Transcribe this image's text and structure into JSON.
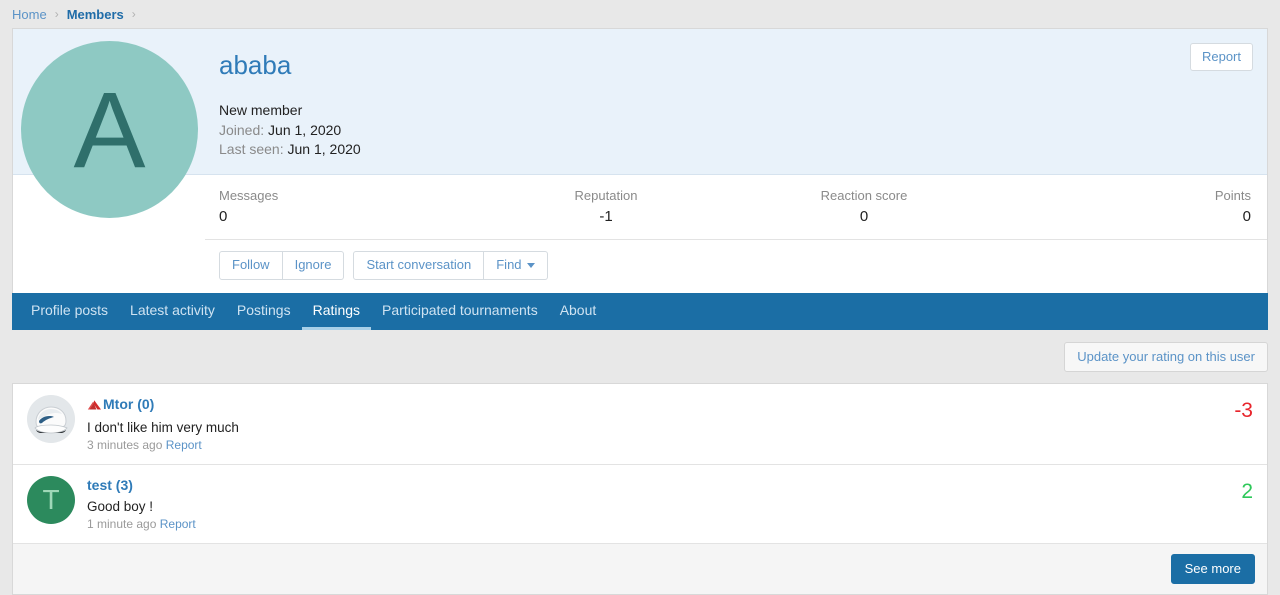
{
  "breadcrumb": {
    "items": [
      {
        "label": "Home",
        "icon": "chevron-right-icon"
      },
      {
        "label": "Members",
        "icon": "chevron-right-icon"
      }
    ],
    "separator": "›"
  },
  "member": {
    "name": "ababa",
    "avatar_letter": "A",
    "avatar_bg": "#8ec9c3",
    "avatar_fg": "#2f6f6b",
    "title": "New member",
    "joined_label": "Joined:",
    "joined_value": "Jun 1, 2020",
    "last_seen_label": "Last seen:",
    "last_seen_value": "Jun 1, 2020",
    "report_label": "Report"
  },
  "stats": [
    {
      "label": "Messages",
      "value": "0"
    },
    {
      "label": "Reputation",
      "value": "-1"
    },
    {
      "label": "Reaction score",
      "value": "0"
    },
    {
      "label": "Points",
      "value": "0"
    }
  ],
  "actions": {
    "follow_label": "Follow",
    "ignore_label": "Ignore",
    "start_conversation_label": "Start conversation",
    "find_label": "Find",
    "find_caret_icon": "caret-down-icon"
  },
  "tabs": [
    {
      "label": "Profile posts",
      "active": false
    },
    {
      "label": "Latest activity",
      "active": false
    },
    {
      "label": "Postings",
      "active": false
    },
    {
      "label": "Ratings",
      "active": true
    },
    {
      "label": "Participated tournaments",
      "active": false
    },
    {
      "label": "About",
      "active": false
    }
  ],
  "ratings": {
    "update_button_label": "Update your rating on this user",
    "see_more_label": "See more",
    "report_link_label": "Report",
    "items": [
      {
        "author": "Mtor",
        "author_count": "(0)",
        "rank_icon": "red-rank-arrow-icon",
        "avatar_type": "helmet-avatar",
        "comment": "I don't like him very much",
        "time": "3 minutes ago",
        "report": "Report",
        "score": "-3",
        "score_color": "#e8252c"
      },
      {
        "author": "test",
        "author_count": "(3)",
        "rank_icon": "none",
        "avatar_type": "letter-avatar",
        "avatar_letter": "T",
        "avatar_bg": "#2c8a5d",
        "comment": "Good boy !",
        "time": "1 minute ago",
        "report": "Report",
        "score": "2",
        "score_color": "#2ec85a"
      }
    ]
  }
}
